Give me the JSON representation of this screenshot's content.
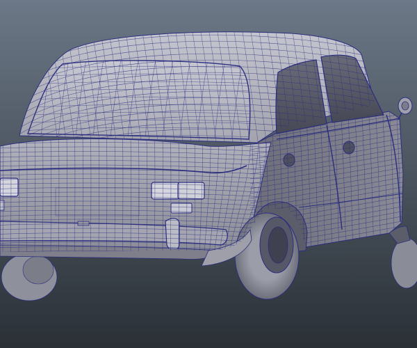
{
  "app": {
    "view": "perspective-viewport",
    "display_mode": "wireframe-on-shaded"
  },
  "viewport": {
    "background": {
      "top": "#6c7887",
      "bottom": "#2a3036"
    }
  },
  "model": {
    "object": "sedan-car",
    "colors": {
      "surface_light": "#b9bac3",
      "surface_mid": "#9e9fa9",
      "surface_dark": "#6f707c",
      "surface_shadow": "#4c4d5a",
      "wire": "#2b2d7e",
      "window_glass": "#4a4b58",
      "window_glass_light": "#6a6b78",
      "tire": "#8e909c",
      "tire_dark": "#5e606d"
    }
  }
}
